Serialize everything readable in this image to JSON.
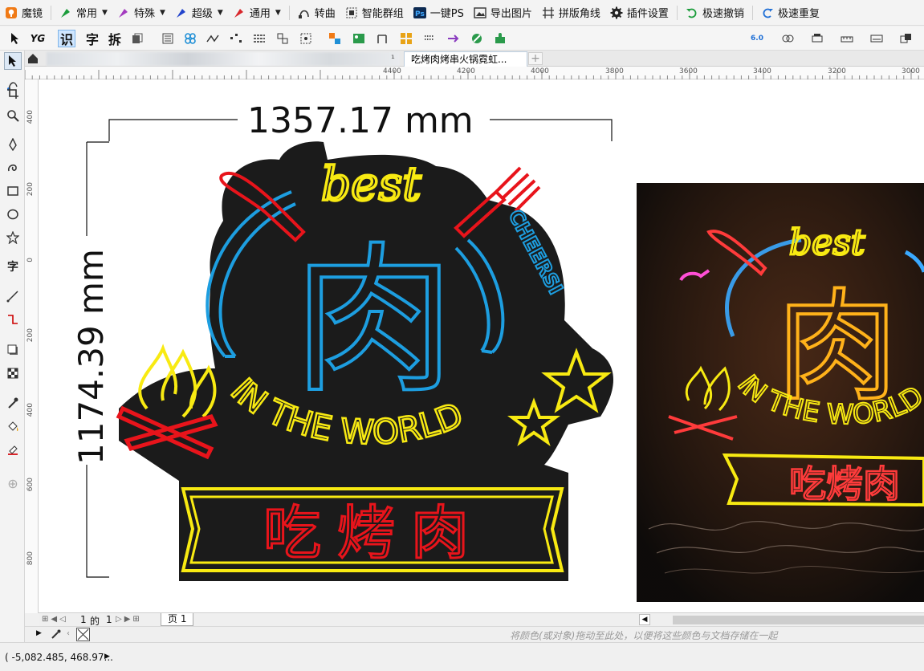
{
  "app": {
    "name": "魔镜"
  },
  "toolbar": {
    "items": [
      {
        "label": "常用",
        "dropdown": true
      },
      {
        "label": "特殊",
        "dropdown": true
      },
      {
        "label": "超级",
        "dropdown": true
      },
      {
        "label": "通用",
        "dropdown": true
      },
      {
        "label": "转曲"
      },
      {
        "label": "智能群组"
      },
      {
        "label": "一键PS"
      },
      {
        "label": "导出图片"
      },
      {
        "label": "拼版角线"
      },
      {
        "label": "插件设置"
      },
      {
        "label": "极速撤销"
      },
      {
        "label": "极速重复"
      }
    ]
  },
  "toolbar2": {
    "chars": [
      "识",
      "字",
      "拆"
    ],
    "cut_version": "6.0"
  },
  "tabs": {
    "active": "吃烤肉烤串火锅霓虹...",
    "partial_sep": "¹"
  },
  "ruler": {
    "h_labels": [
      "4400",
      "4200",
      "4000",
      "3800",
      "3600",
      "3400",
      "3200",
      "3000"
    ],
    "v_labels": [
      "400",
      "200",
      "0",
      "200",
      "400",
      "600",
      "800"
    ]
  },
  "design": {
    "dim_width": "1357.17 mm",
    "dim_height": "1174.39 mm",
    "sign_best": "best",
    "sign_meat": "肉",
    "sign_cheers": "CHEERSI",
    "sign_in_the_world": "IN THE WORLD",
    "sign_banner": "吃烤肉"
  },
  "page_nav": {
    "current": "1",
    "of_label": "的",
    "total": "1",
    "page_tab": "页 1"
  },
  "palette": {
    "hint": "将颜色(或对象)拖动至此处，以便将这些颜色与文档存储在一起"
  },
  "status": {
    "coords": "( -5,082.485, 468.97..."
  },
  "colors": {
    "neon_red": "#e8141b",
    "neon_yellow": "#f8ea12",
    "neon_blue": "#1d9ee0",
    "sign_fill": "#1b1b1b"
  }
}
